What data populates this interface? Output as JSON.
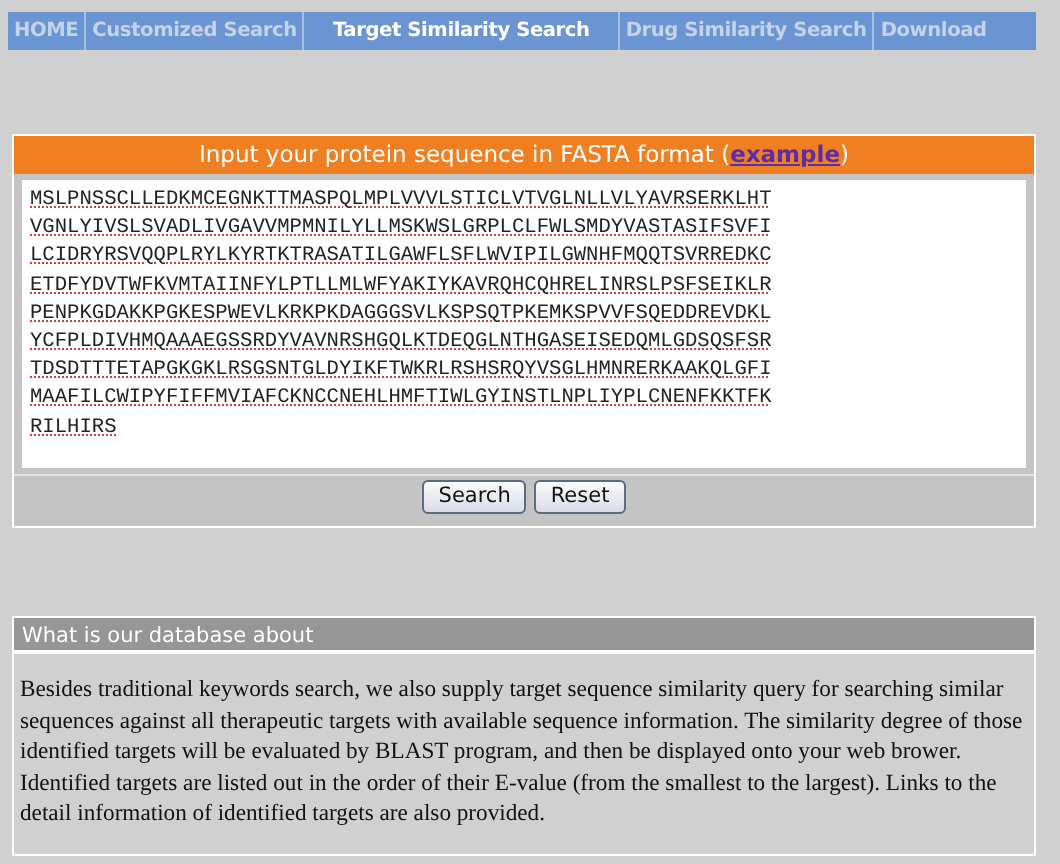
{
  "nav": [
    {
      "label": "HOME",
      "selected": false
    },
    {
      "label": "Customized Search",
      "selected": false
    },
    {
      "label": "Target Similarity Search",
      "selected": true
    },
    {
      "label": "Drug Similarity Search",
      "selected": false
    },
    {
      "label": "Download",
      "selected": false
    }
  ],
  "input_panel": {
    "title_before": "Input your protein sequence in FASTA format (",
    "title_link": "example",
    "title_after": ")",
    "sequence_lines": [
      "MSLPNSSCLLEDKMCEGNKTTMASPQLMPLVVVLSTICLVTVGLNLLVLYAVRSERKLHT",
      "VGNLYIVSLSVADLIVGAVVMPMNILYLLMSKWSLGRPLCLFWLSMDYVASTASIFSVFI",
      "LCIDRYRSVQQPLRYLKYRTKTRASATILGAWFLSFLWVIPILGWNHFMQQTSVRREDKC",
      "ETDFYDVTWFKVMTAIINFYLPTLLMLWFYAKIYKAVRQHCQHRELINRSLPSFSEIKLR",
      "PENPKGDAKKPGKESPWEVLKRKPKDAGGGSVLKSPSQTPKEMKSPVVFSQEDDREVDKL",
      "YCFPLDIVHMQAAAEGSSRDYVAVNRSHGQLKTDEQGLNTHGASEISEDQMLGDSQSFSR",
      "TDSDTTTETAPGKGKLRSGSNTGLDYIKFTWKRLRSHSRQYVSGLHMNRERKAAKQLGFI",
      "MAAFILCWIPYFIFFMVIAFCKNCCNEHLHMFTIWLGYINSTLNPLIYPLCNENFKKTFK",
      "RILHIRS"
    ],
    "buttons": [
      "Search",
      "Reset"
    ]
  },
  "about": {
    "title": "What is our database about",
    "text": "Besides traditional keywords search, we also supply target sequence similarity query for searching similar sequences against all therapeutic targets with available sequence information. The similarity degree of those identified targets will be evaluated by BLAST program, and then be displayed onto your web brower. Identified targets are listed out in the order of their E-value (from the smallest to the largest). Links to the detail information of identified targets are also provided."
  }
}
